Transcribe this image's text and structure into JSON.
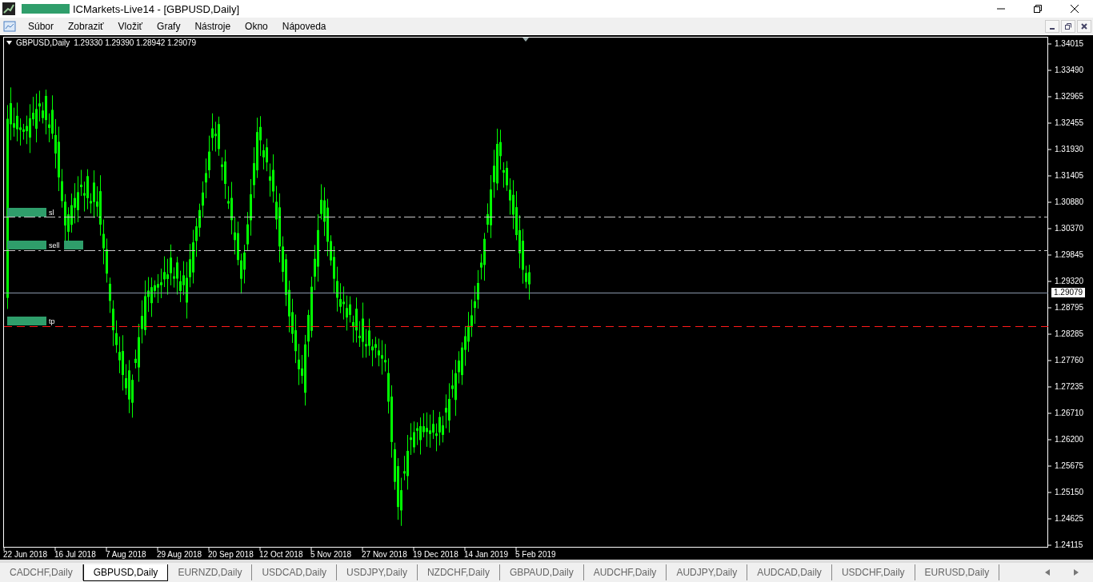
{
  "window": {
    "title": "ICMarkets-Live14 - [GBPUSD,Daily]"
  },
  "menu": [
    "Súbor",
    "Zobraziť",
    "Vložiť",
    "Grafy",
    "Nástroje",
    "Okno",
    "Nápoveda"
  ],
  "chart": {
    "symbol": "GBPUSD,Daily",
    "ohlc": "1.29330 1.29390 1.28942 1.29079",
    "price_ticks": [
      "1.34015",
      "1.33490",
      "1.32965",
      "1.32455",
      "1.31930",
      "1.31405",
      "1.30880",
      "1.30370",
      "1.29845",
      "1.29320",
      "1.28795",
      "1.28285",
      "1.27760",
      "1.27235",
      "1.26710",
      "1.26200",
      "1.25675",
      "1.25150",
      "1.24625",
      "1.24115"
    ],
    "current_price": "1.29079",
    "date_labels": [
      "22 Jun 2018",
      "16 Jul 2018",
      "7 Aug 2018",
      "29 Aug 2018",
      "20 Sep 2018",
      "12 Oct 2018",
      "5 Nov 2018",
      "27 Nov 2018",
      "19 Dec 2018",
      "14 Jan 2019",
      "5 Feb 2019"
    ],
    "levels": [
      {
        "label": "sl",
        "kind": "stop"
      },
      {
        "label": "sell",
        "kind": "entry"
      },
      {
        "label": "tp",
        "kind": "target"
      }
    ]
  },
  "tabs": [
    {
      "label": "CADCHF,Daily",
      "selected": false
    },
    {
      "label": "GBPUSD,Daily",
      "selected": true
    },
    {
      "label": "EURNZD,Daily",
      "selected": false
    },
    {
      "label": "USDCAD,Daily",
      "selected": false
    },
    {
      "label": "USDJPY,Daily",
      "selected": false
    },
    {
      "label": "NZDCHF,Daily",
      "selected": false
    },
    {
      "label": "GBPAUD,Daily",
      "selected": false
    },
    {
      "label": "AUDCHF,Daily",
      "selected": false
    },
    {
      "label": "AUDJPY,Daily",
      "selected": false
    },
    {
      "label": "AUDCAD,Daily",
      "selected": false
    },
    {
      "label": "USDCHF,Daily",
      "selected": false
    },
    {
      "label": "EURUSD,Daily",
      "selected": false
    }
  ]
}
